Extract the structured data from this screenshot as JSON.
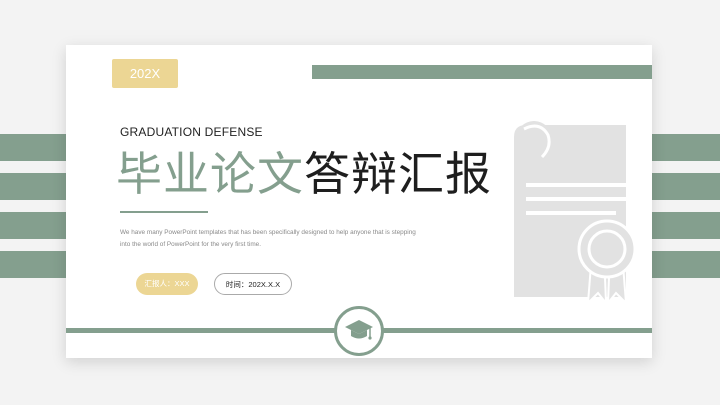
{
  "slide": {
    "year": "202X",
    "subtitle": "GRADUATION DEFENSE",
    "title_green": "毕业论文",
    "title_dark": "答辩汇报",
    "description_line1": "We have many PowerPoint templates that has been specifically designed to help anyone that is stepping",
    "description_line2": "into the world of PowerPoint for the very first time.",
    "reporter_label": "汇报人：XXX",
    "time_label": "时间：202X.X.X"
  },
  "icons": {
    "center": "graduation-cap-icon",
    "right": "certificate-icon"
  },
  "colors": {
    "accent_green": "#849f8e",
    "accent_yellow": "#ecd694",
    "text_dark": "#1e1e1e",
    "background": "#f3f3f3",
    "illustration_gray": "#e2e2e2"
  }
}
